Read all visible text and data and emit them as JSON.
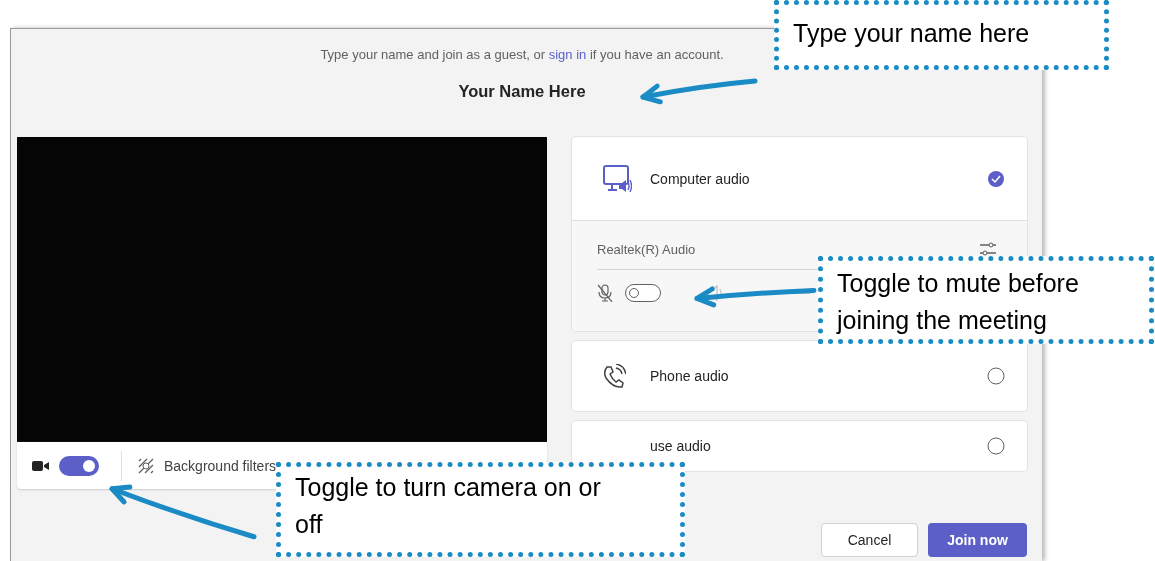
{
  "prejoin": {
    "instruction": {
      "before": "Type your name and join as a guest, or ",
      "link": "sign in",
      "after": " if you have an account."
    },
    "name": "Your Name Here",
    "camera": {
      "on": true
    },
    "background_filters": "Background filters",
    "audio_options": [
      {
        "kind": "computer",
        "label": "Computer audio",
        "selected": true,
        "device": "Realtek(R) Audio",
        "mic_on": false
      },
      {
        "kind": "phone",
        "label": "Phone audio",
        "selected": false
      },
      {
        "kind": "none",
        "label": "use audio",
        "selected": false
      }
    ],
    "buttons": [
      {
        "kind": "secondary",
        "label": "Cancel"
      },
      {
        "kind": "primary",
        "label": "Join now"
      }
    ]
  },
  "callouts": [
    {
      "text": "Type your name here"
    },
    {
      "text": "Toggle to mute before joining the meeting"
    },
    {
      "text": "Toggle to turn camera on or off"
    }
  ]
}
